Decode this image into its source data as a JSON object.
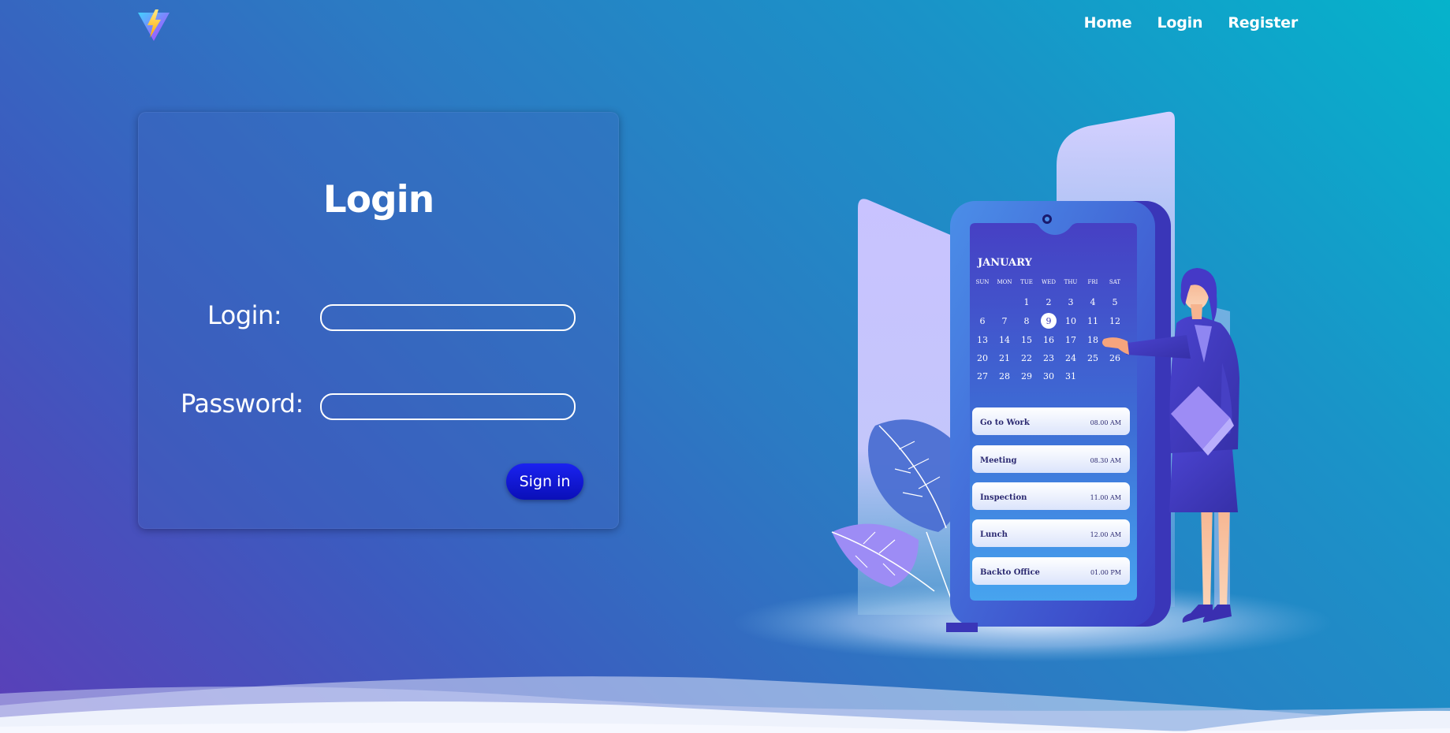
{
  "nav": {
    "links": [
      "Home",
      "Login",
      "Register"
    ]
  },
  "login_form": {
    "title": "Login",
    "login_label": "Login:",
    "password_label": "Password:",
    "login_value": "",
    "password_value": "",
    "submit_label": "Sign in"
  },
  "calendar": {
    "month": "JANUARY",
    "weekdays": [
      "SUN",
      "MON",
      "TUE",
      "WED",
      "THU",
      "FRI",
      "SAT"
    ],
    "weeks": [
      [
        "",
        "",
        "1",
        "2",
        "3",
        "4",
        "5"
      ],
      [
        "6",
        "7",
        "8",
        "9",
        "10",
        "11",
        "12"
      ],
      [
        "13",
        "14",
        "15",
        "16",
        "17",
        "18",
        ""
      ],
      [
        "20",
        "21",
        "22",
        "23",
        "24",
        "25",
        "26"
      ],
      [
        "27",
        "28",
        "29",
        "30",
        "31",
        "",
        ""
      ]
    ],
    "selected_day": "9"
  },
  "schedule": [
    {
      "task": "Go to Work",
      "time": "08.00 AM"
    },
    {
      "task": "Meeting",
      "time": "08.30 AM"
    },
    {
      "task": "Inspection",
      "time": "11.00 AM"
    },
    {
      "task": "Lunch",
      "time": "12.00 AM"
    },
    {
      "task": "Backto Office",
      "time": "01.00 PM"
    }
  ],
  "colors": {
    "accent": "#0a0fb8",
    "bg_start": "#5a3fb8",
    "bg_end": "#05b3cb"
  },
  "icons": {
    "logo": "lightning-bolt-logo-icon"
  }
}
